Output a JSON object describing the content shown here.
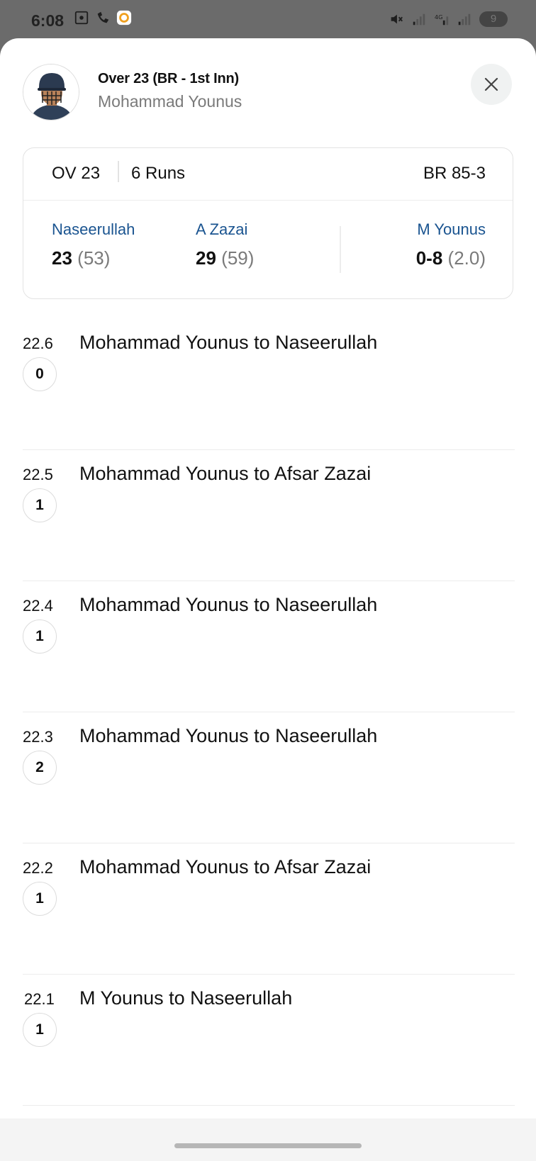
{
  "status_bar": {
    "time": "6:08",
    "battery": "9",
    "icons_left": [
      "screenshot-icon",
      "call-icon",
      "app-notification-icon"
    ],
    "icons_right": [
      "mute-icon",
      "signal-icon",
      "4g-signal-icon",
      "signal-icon",
      "battery-icon"
    ]
  },
  "header": {
    "title": "Over 23 (BR - 1st Inn)",
    "subtitle": "Mohammad Younus"
  },
  "summary": {
    "over": "OV 23",
    "runs": "6 Runs",
    "score": "BR 85-3",
    "batters": [
      {
        "name": "Naseerullah",
        "runs": "23",
        "balls": "(53)"
      },
      {
        "name": "A Zazai",
        "runs": "29",
        "balls": "(59)"
      }
    ],
    "bowler": {
      "name": "M Younus",
      "figures": "0-8",
      "overs": "(2.0)"
    }
  },
  "balls": [
    {
      "num": "22.6",
      "desc": "Mohammad Younus to Naseerullah",
      "runs": "0"
    },
    {
      "num": "22.5",
      "desc": "Mohammad Younus to Afsar Zazai",
      "runs": "1"
    },
    {
      "num": "22.4",
      "desc": "Mohammad Younus to Naseerullah",
      "runs": "1"
    },
    {
      "num": "22.3",
      "desc": "Mohammad Younus to Naseerullah",
      "runs": "2"
    },
    {
      "num": "22.2",
      "desc": "Mohammad Younus to Afsar Zazai",
      "runs": "1"
    },
    {
      "num": "22.1",
      "desc": "M Younus to Naseerullah",
      "runs": "1"
    }
  ],
  "colors": {
    "player_name": "#1a5490",
    "secondary_text": "#7a7a7a",
    "divider": "#ececec"
  }
}
